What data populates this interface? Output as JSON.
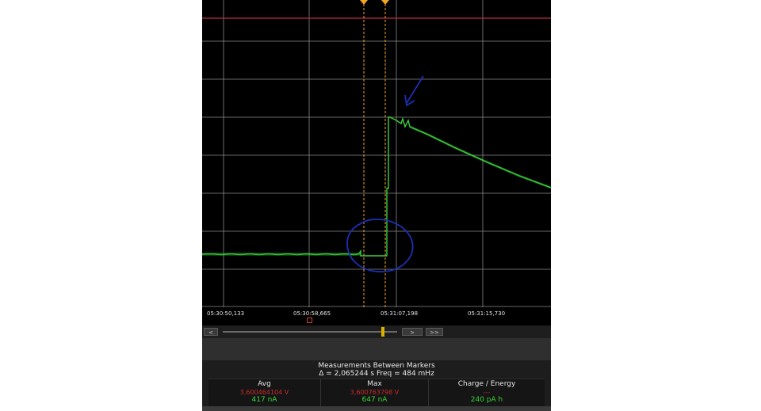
{
  "time_axis": {
    "ticks": [
      "05:30:50,133",
      "05:30:58,665",
      "05:31:07,198",
      "05:31:15,730"
    ]
  },
  "nav": {
    "prev_label": "<",
    "next_label": ">",
    "end_label": ">>"
  },
  "measurements": {
    "title": "Measurements Between Markers",
    "delta_line": "Δ = 2,065244 s    Freq = 484 mHz",
    "columns": [
      {
        "header": "Avg",
        "voltage": "3,600464104 V",
        "current": "417 nA"
      },
      {
        "header": "Max",
        "voltage": "3,600763798 V",
        "current": "647 nA"
      },
      {
        "header": "Charge / Energy",
        "voltage": "---",
        "current": "240 pA h"
      }
    ]
  },
  "colors": {
    "trace": "#3ad13a",
    "grid": "#8a8a8a",
    "marker": "#f5a623",
    "reference_line": "#c0284a",
    "annotation": "#1c2fb5"
  },
  "icons": {
    "marker": "marker-flag-icon",
    "annotation_arrow": "arrow-icon",
    "annotation_circle": "circle-annotation-icon"
  }
}
